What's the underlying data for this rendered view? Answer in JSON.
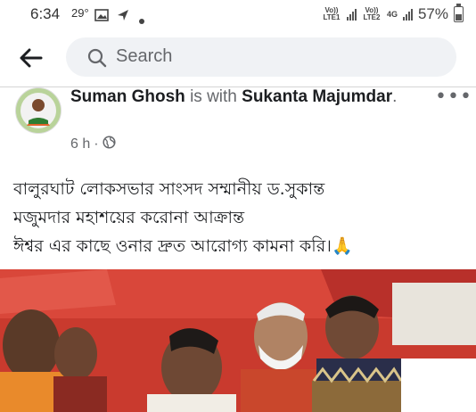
{
  "status_bar": {
    "time": "6:34",
    "temperature": "29°",
    "sim1_label": "Vo)) LTE1",
    "sim2_label": "Vo)) LTE2",
    "network": "4G",
    "battery": "57%",
    "battery_level": 0.57
  },
  "header": {
    "search_placeholder": "Search"
  },
  "post": {
    "author": "Suman Ghosh",
    "with_text": "is with",
    "tagged": "Sukanta Majumdar",
    "time": "6 h",
    "separator": "·",
    "text_lines": [
      "বালুরঘাট লোকসভার সাংসদ সম্মানীয় ড.সুকান্ত",
      "মজুমদার মহাশয়ের করোনা আক্রান্ত",
      "ঈশ্বর এর কাছে ওনার দ্রুত আরোগ্য কামনা করি।🙏"
    ],
    "more_label": "•••"
  },
  "colors": {
    "accent_search_bg": "#f0f2f5",
    "photo_red": "#c93a2e"
  }
}
